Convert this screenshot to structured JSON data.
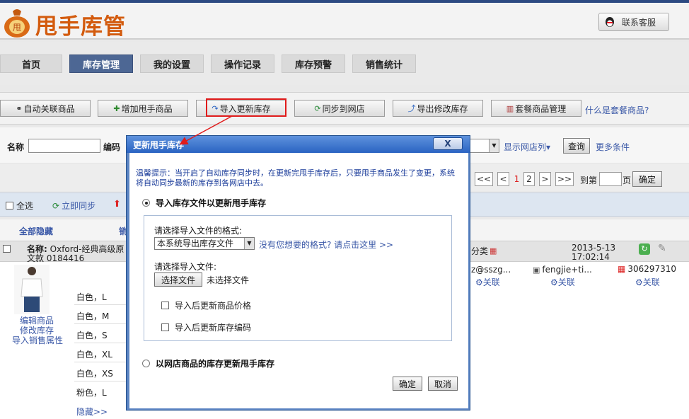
{
  "app": {
    "title": "甩手库管",
    "service_label": "联系客服"
  },
  "nav": {
    "tabs": [
      {
        "label": "首页"
      },
      {
        "label": "库存管理",
        "active": true
      },
      {
        "label": "我的设置"
      },
      {
        "label": "操作记录"
      },
      {
        "label": "库存预警"
      },
      {
        "label": "销售统计"
      }
    ]
  },
  "actions": {
    "buttons": [
      {
        "label": "自动关联商品"
      },
      {
        "label": "增加甩手商品"
      },
      {
        "label": "导入更新库存"
      },
      {
        "label": "同步到网店"
      },
      {
        "label": "导出修改库存"
      },
      {
        "label": "套餐商品管理"
      }
    ],
    "help_link": "什么是套餐商品?"
  },
  "search": {
    "name_label": "名称",
    "code_label": "编码",
    "show_shop_columns": "显示网店列▾",
    "query_button": "查询",
    "more_conditions": "更多条件"
  },
  "pager": {
    "first": "<<",
    "prev": "<",
    "pages": [
      "1",
      "2"
    ],
    "next": ">",
    "last": ">>",
    "goto_label": "到第",
    "page_unit": "页",
    "confirm": "确定"
  },
  "toolbar2": {
    "select_all": "全选",
    "sync_now": "立即同步"
  },
  "table_head": {
    "hide_all": "全部隐藏",
    "col2": "销"
  },
  "item": {
    "name_label": "名称:",
    "name_value": "Oxford-经典高级原",
    "style_label": "文款 0184416",
    "category": "分类",
    "date": "2013-5-13",
    "time": "17:02:14",
    "actions": [
      "编辑商品",
      "修改库存",
      "导入销售属性"
    ],
    "skus": [
      "白色，L",
      "白色，M",
      "白色，S",
      "白色，XL",
      "白色，XS",
      "粉色，L"
    ],
    "hide_link": "隐藏>>",
    "shop1": "z@sszg...",
    "shop2": "fengjie+ti...",
    "shop3": "306297310",
    "link_label": "关联"
  },
  "dialog": {
    "title": "更新甩手库存",
    "close": "X",
    "tip": "温馨提示：当开启了自动库存同步时，在更新完甩手库存后，只要甩手商品发生了变更，系统将自动同步最新的库存到各网店中去。",
    "option1": "导入库存文件以更新甩手库存",
    "format_label": "请选择导入文件的格式:",
    "format_selected": "本系统导出库存文件",
    "format_link": "没有您想要的格式? 请点击这里 >>",
    "file_label": "请选择导入文件:",
    "file_button": "选择文件",
    "file_status": "未选择文件",
    "check1": "导入后更新商品价格",
    "check2": "导入后更新库存编码",
    "option2": "以网店商品的库存更新甩手库存",
    "ok": "确定",
    "cancel": "取消"
  },
  "colors": {
    "accent": "#4d6794",
    "dialog_title": "#2a63c2",
    "logo": "#d35b0e",
    "highlight": "#e01b1b"
  }
}
